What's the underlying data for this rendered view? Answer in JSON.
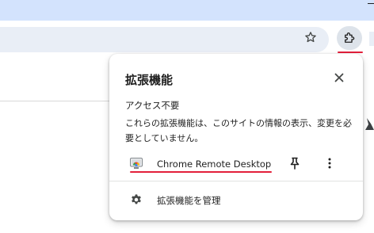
{
  "browser": {
    "toolbar": {
      "bookmark_icon": "star-outline-icon",
      "extensions_icon": "puzzle-piece-icon"
    },
    "colors": {
      "titlebar": "#d3e3fd",
      "omnibox": "#e9eef6",
      "extensions_button_active": "#dde3ea",
      "highlight_underline": "#e3203b"
    }
  },
  "extensions_menu": {
    "title": "拡張機能",
    "close_icon": "close-icon",
    "section": {
      "title": "アクセス不要",
      "description": "これらの拡張機能は、このサイトの情報の表示、変更を必要としていません。"
    },
    "extensions": [
      {
        "name": "Chrome Remote Desktop",
        "icon": "chrome-remote-desktop-icon",
        "pin_icon": "pin-icon",
        "more_icon": "more-vertical-icon"
      }
    ],
    "manage": {
      "label": "拡張機能を管理",
      "icon": "gear-icon"
    }
  }
}
